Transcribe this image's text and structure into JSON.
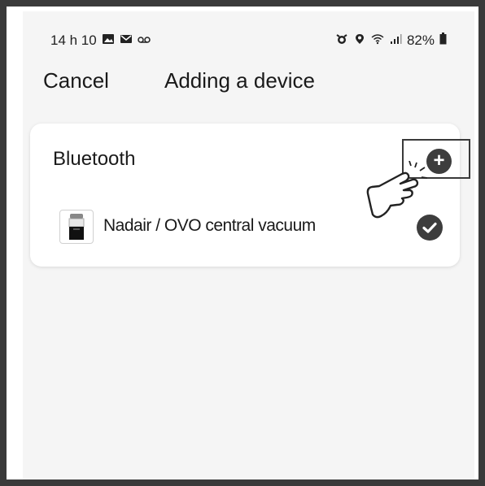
{
  "status_bar": {
    "time": "14 h 10",
    "battery": "82%"
  },
  "header": {
    "cancel_label": "Cancel",
    "title": "Adding a device"
  },
  "bluetooth_section": {
    "title": "Bluetooth",
    "devices": [
      {
        "name": "Nadair / OVO central vacuum",
        "selected": true
      }
    ]
  },
  "colors": {
    "icon_dark": "#3d3d3d",
    "background": "#f5f5f5",
    "card": "#ffffff"
  }
}
